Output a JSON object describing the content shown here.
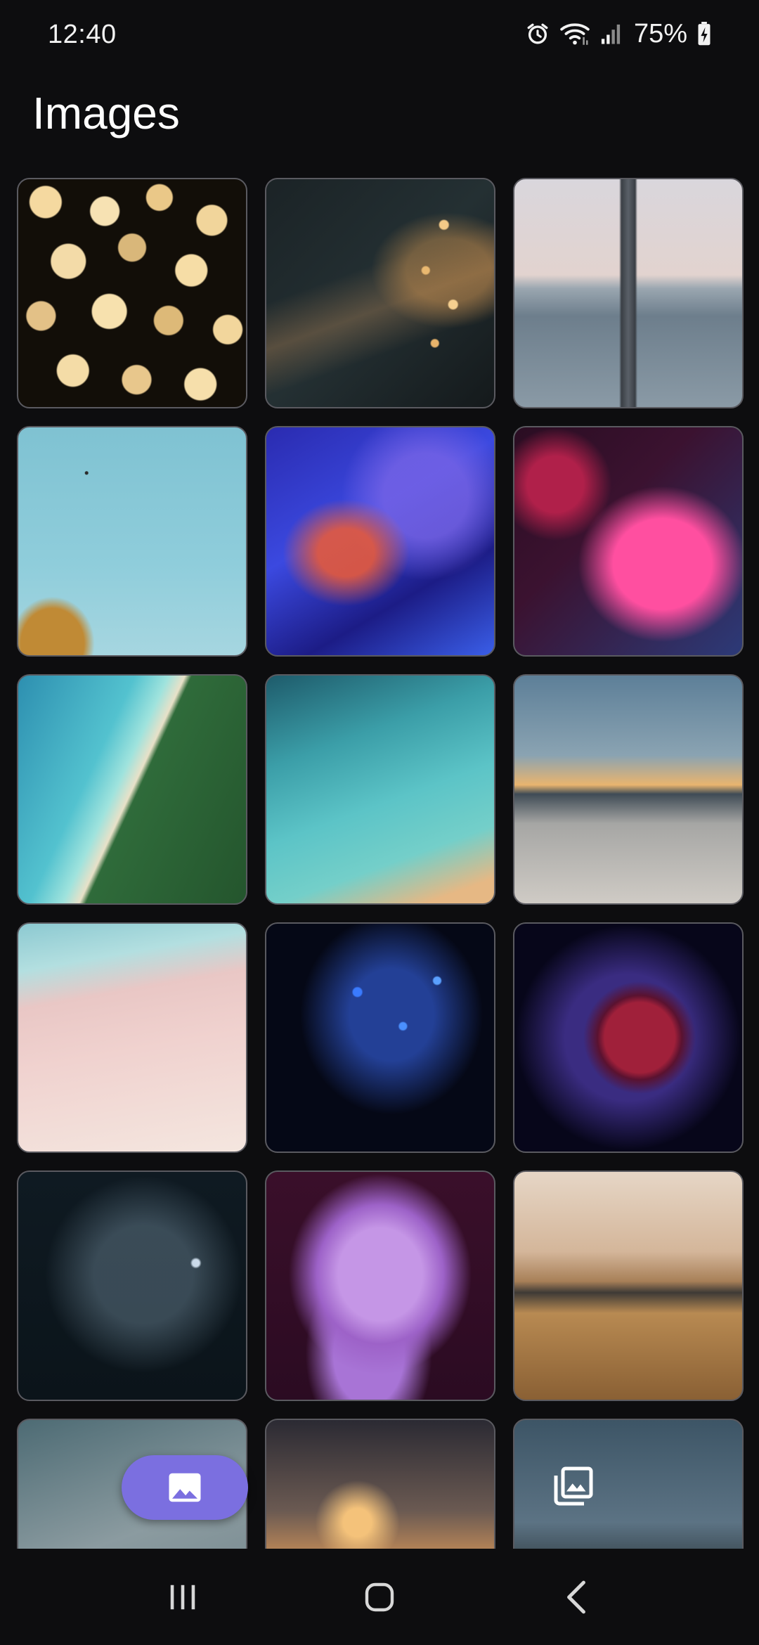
{
  "status_bar": {
    "time": "12:40",
    "battery_percent": "75%",
    "icons": [
      "alarm-icon",
      "wifi-icon",
      "cell-signal-icon",
      "battery-charging-icon"
    ]
  },
  "page": {
    "title": "Images"
  },
  "grid": {
    "tiles": [
      {
        "name": "image-gold-bokeh",
        "style": "t-bokeh-gold"
      },
      {
        "name": "image-string-lights",
        "style": "t-string-lights"
      },
      {
        "name": "image-feather",
        "style": "t-feather"
      },
      {
        "name": "image-birds-sky",
        "style": "t-birds"
      },
      {
        "name": "image-blue-abstract",
        "style": "t-blue-abstract"
      },
      {
        "name": "image-pink-blur",
        "style": "t-pink-blur"
      },
      {
        "name": "image-coast-aerial",
        "style": "t-coast"
      },
      {
        "name": "image-sea-aerial",
        "style": "t-sea-aerial"
      },
      {
        "name": "image-lifeguard-beach",
        "style": "t-beach"
      },
      {
        "name": "image-pink-sand",
        "style": "t-pink-sand"
      },
      {
        "name": "image-fiber-optics",
        "style": "t-fiber"
      },
      {
        "name": "image-plasma-ball",
        "style": "t-plasma"
      },
      {
        "name": "image-light-cubes",
        "style": "t-cubes"
      },
      {
        "name": "image-purple-ink",
        "style": "t-ink"
      },
      {
        "name": "image-grass-sunset",
        "style": "t-grass-sunset"
      },
      {
        "name": "image-palm-leaves",
        "style": "t-palm"
      },
      {
        "name": "image-sunset-reeds",
        "style": "t-sunset-reeds"
      },
      {
        "name": "image-forest-sky",
        "style": "t-forest"
      }
    ]
  },
  "fab": {
    "icon": "image-icon",
    "color": "#7b6fe0"
  },
  "overlay": {
    "icon": "photo-library-icon"
  },
  "nav_bar": {
    "buttons": [
      "recent-apps-icon",
      "home-icon",
      "back-icon"
    ]
  }
}
